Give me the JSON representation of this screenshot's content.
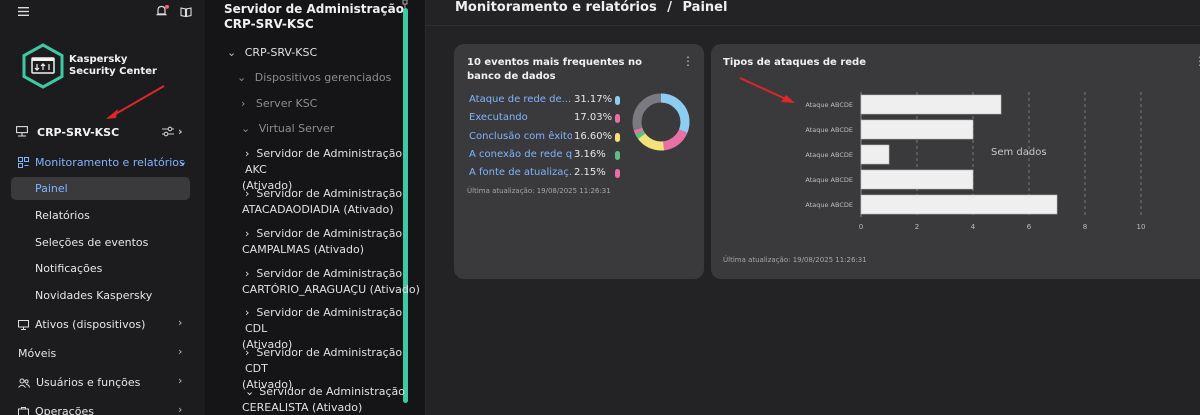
{
  "app": {
    "name_line1": "Kaspersky",
    "name_line2": "Security Center"
  },
  "nav": {
    "server_label": "CRP-SRV-KSC",
    "monitoring": "Monitoramento e relatórios",
    "sub": [
      "Painel",
      "Relatórios",
      "Seleções de eventos",
      "Notificações",
      "Novidades Kaspersky"
    ],
    "assets": "Ativos (dispositivos)",
    "mobile": "Móveis",
    "users": "Usuários e funções",
    "operations": "Operações"
  },
  "tree": {
    "title": "Servidor de Administração CRP-SRV-KSC",
    "root": "CRP-SRV-KSC",
    "managed": "Dispositivos gerenciados",
    "server_ksc": "Server KSC",
    "virtual": "Virtual Server",
    "items": [
      {
        "l1": "Servidor de Administração AKC",
        "l2": "(Ativado)"
      },
      {
        "l1": "Servidor de Administração",
        "l2": "ATACADAODIADIA (Ativado)"
      },
      {
        "l1": "Servidor de Administração",
        "l2": "CAMPALMAS (Ativado)"
      },
      {
        "l1": "Servidor de Administração",
        "l2": "CARTÓRIO_ARAGUAÇU (Ativado)"
      },
      {
        "l1": "Servidor de Administração CDL",
        "l2": "(Ativado)"
      },
      {
        "l1": "Servidor de Administração CDT",
        "l2": "(Ativado)"
      },
      {
        "l1": "Servidor de Administração",
        "l2": "CEREALISTA (Ativado)"
      }
    ]
  },
  "breadcrumb": {
    "section": "Monitoramento e relatórios",
    "sep": "/",
    "page": "Painel"
  },
  "widget_events": {
    "title": "10 eventos mais frequentes no banco de dados",
    "rows": [
      {
        "label": "Ataque de rede de...",
        "value": "31.17%",
        "color": "#8ecdf2"
      },
      {
        "label": "Executando",
        "value": "17.03%",
        "color": "#e96fa5"
      },
      {
        "label": "Conclusão com êxito",
        "value": "16.60%",
        "color": "#f3e27a"
      },
      {
        "label": "A conexão de rede q...",
        "value": "3.16%",
        "color": "#5bbf82"
      },
      {
        "label": "A fonte de atualizaç...",
        "value": "2.15%",
        "color": "#e96fa5"
      }
    ],
    "updated": "Última atualização: 19/08/2025 11:26:31"
  },
  "widget_attacks": {
    "title": "Tipos de ataques de rede",
    "no_data": "Sem dados",
    "updated": "Última atualização: 19/08/2025 11:26:31"
  },
  "chart_data": [
    {
      "type": "pie",
      "categories": [
        "Ataque de rede de...",
        "Executando",
        "Conclusão com êxito",
        "A conexão de rede q...",
        "A fonte de atualizaç..."
      ],
      "values": [
        31.17,
        17.03,
        16.6,
        3.16,
        2.15
      ],
      "colors": [
        "#8ecdf2",
        "#e96fa5",
        "#f3e27a",
        "#5bbf82",
        "#e96fa5"
      ],
      "rest_color": "#7a7a80"
    },
    {
      "type": "bar",
      "orientation": "horizontal",
      "categories": [
        "Ataque ABCDE",
        "Ataque ABCDE",
        "Ataque ABCDE",
        "Ataque ABCDE",
        "Ataque ABCDE"
      ],
      "values": [
        5,
        4,
        1,
        4,
        7
      ],
      "xticks": [
        "0",
        "2",
        "4",
        "6",
        "8",
        "10"
      ],
      "xlim": [
        0,
        10
      ],
      "grid": "vertical-dashed"
    }
  ]
}
